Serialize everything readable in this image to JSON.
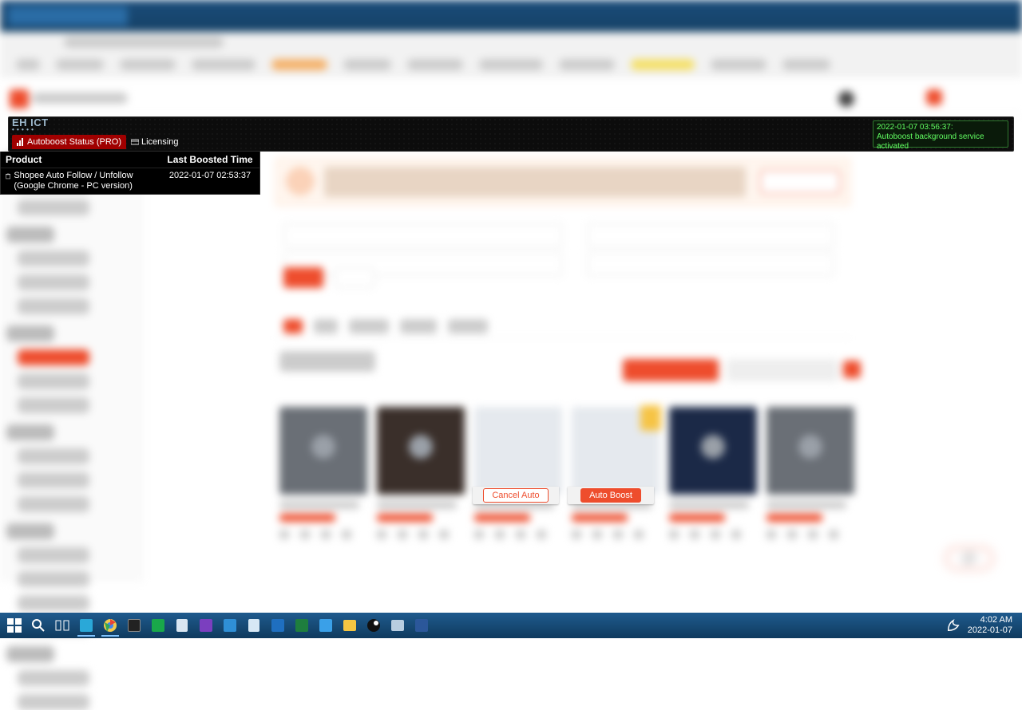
{
  "ext": {
    "logo_top": "EH ICT",
    "logo_sub": "• • • • •",
    "tab_autoboost": "Autoboost Status (PRO)",
    "tab_licensing": "Licensing",
    "status_line1": "2022-01-07 03:56:37:",
    "status_line2": "Autoboost background service activated",
    "col_product": "Product",
    "col_time": "Last Boosted Time",
    "row_product": "Shopee Auto Follow / Unfollow (Google Chrome - PC version)",
    "row_time": "2022-01-07 02:53:37"
  },
  "buttons": {
    "cancel_auto": "Cancel Auto",
    "auto_boost": "Auto Boost"
  },
  "taskbar": {
    "time": "4:02 AM",
    "date": "2022-01-07"
  }
}
